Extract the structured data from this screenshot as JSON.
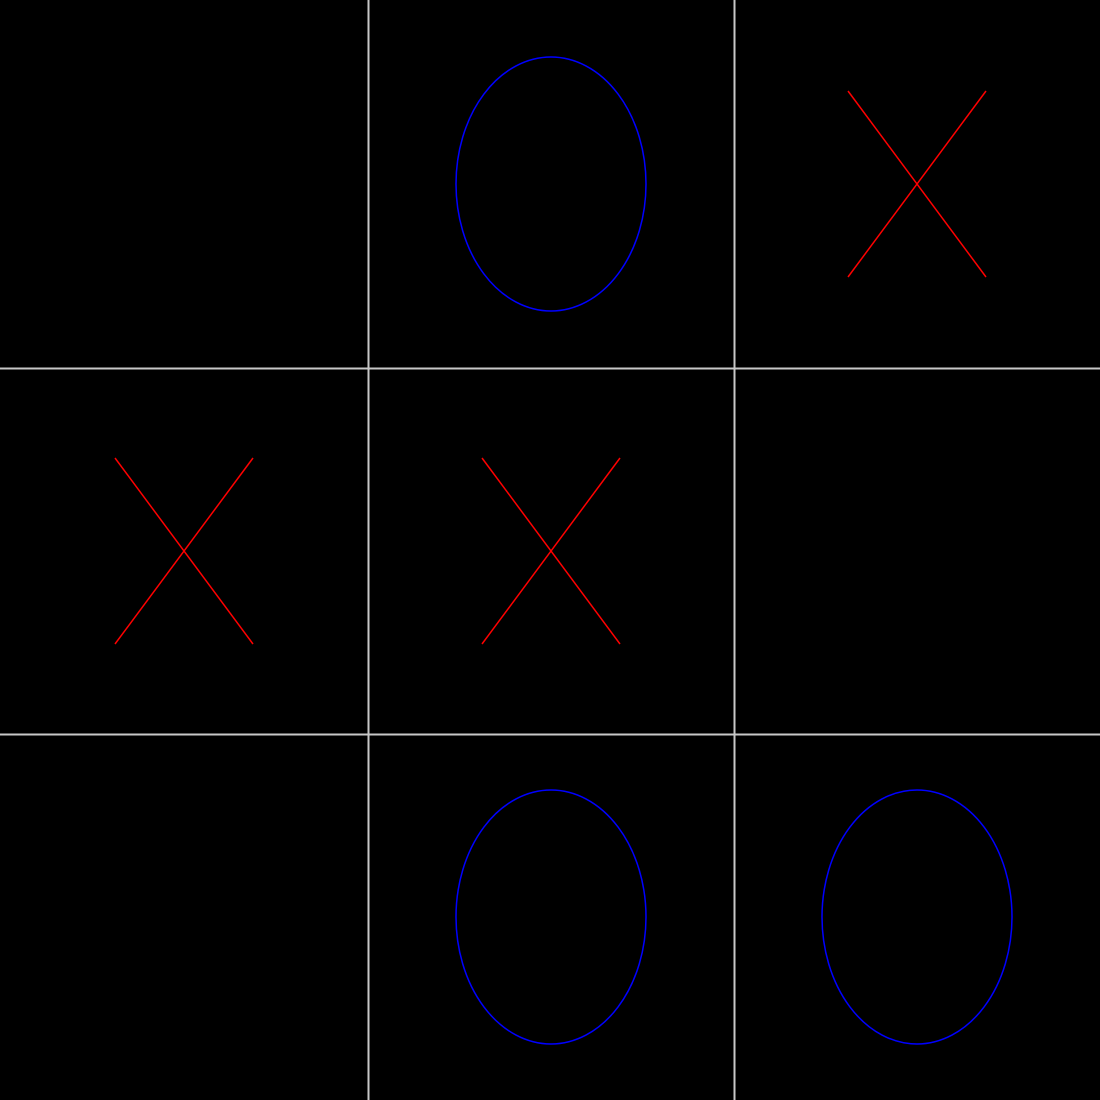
{
  "board": {
    "rows": 3,
    "cols": 3,
    "cells": [
      [
        "",
        "O",
        "X"
      ],
      [
        "X",
        "X",
        ""
      ],
      [
        "",
        "O",
        "O"
      ]
    ]
  },
  "colors": {
    "background": "#000000",
    "grid_line": "#c8c8c8",
    "x_mark": "#ff0000",
    "o_mark": "#0000ff",
    "window_edge": "#2a9d9d"
  }
}
